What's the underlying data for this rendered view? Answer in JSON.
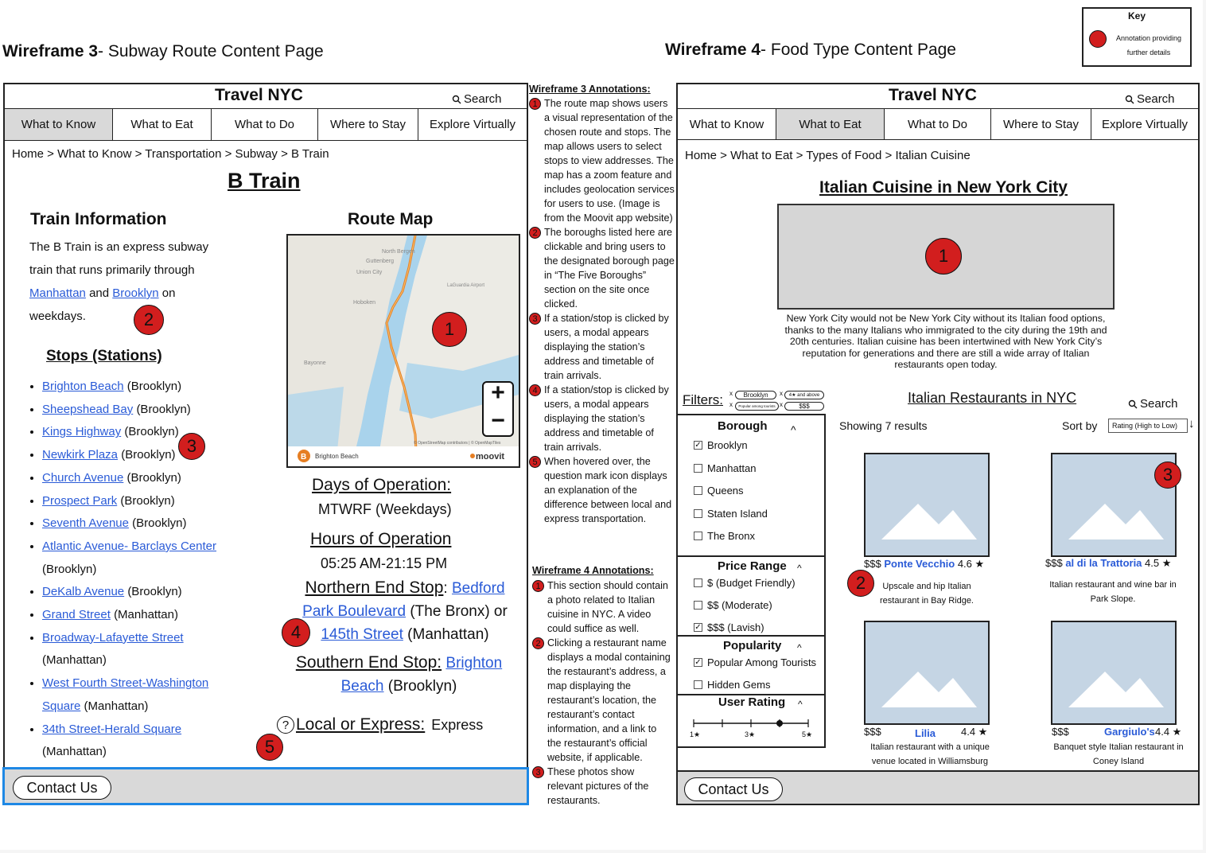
{
  "key": {
    "title": "Key",
    "label": "Annotation providing further details"
  },
  "wf3": {
    "title_bold": "Wireframe 3",
    "title_rest": "- Subway Route Content Page",
    "site_title": "Travel NYC",
    "search": "Search",
    "tabs": [
      "What to Know",
      "What to Eat",
      "What to Do",
      "Where to Stay",
      "Explore Virtually"
    ],
    "breadcrumb": "Home > What to Know > Transportation > Subway > B Train",
    "page_title": "B Train",
    "train_info_heading": "Train Information",
    "train_info_pre": "The B Train is an express subway train that runs primarily through",
    "link_manhattan": "Manhattan",
    "and": "and",
    "link_brooklyn": "Brooklyn",
    "train_info_post": "on weekdays.",
    "stops_heading": "Stops (Stations)",
    "stops": [
      {
        "name": "Brighton Beach",
        "borough": "(Brooklyn)"
      },
      {
        "name": "Sheepshead Bay",
        "borough": "(Brooklyn)"
      },
      {
        "name": "Kings Highway",
        "borough": "(Brooklyn)"
      },
      {
        "name": "Newkirk Plaza",
        "borough": "(Brooklyn)"
      },
      {
        "name": "Church Avenue",
        "borough": "(Brooklyn)"
      },
      {
        "name": "Prospect Park",
        "borough": "(Brooklyn)"
      },
      {
        "name": "Seventh Avenue",
        "borough": "(Brooklyn)"
      },
      {
        "name": "Atlantic Avenue- Barclays Center",
        "borough": "(Brooklyn)"
      },
      {
        "name": "DeKalb Avenue",
        "borough": "(Brooklyn)"
      },
      {
        "name": "Grand Street",
        "borough": "(Manhattan)"
      },
      {
        "name": "Broadway-Lafayette Street",
        "borough": "(Manhattan)"
      },
      {
        "name": "West Fourth Street-Washington Square",
        "borough": "(Manhattan)"
      },
      {
        "name": "34th Street-Herald Square",
        "borough": "(Manhattan)"
      }
    ],
    "route_map_heading": "Route Map",
    "map_labels": {
      "north_bergen": "North Bergen",
      "guttenberg": "Guttenberg",
      "union_city": "Union City",
      "laguardia": "LaGuardia Airport",
      "hoboken": "Hoboken",
      "bayonne": "Bayonne",
      "brighton_beach": "Brighton Beach",
      "moovit": "moovit",
      "attribution": "© OpenStreetMap contributors | © OpenMapTiles"
    },
    "days_heading": "Days of Operation:",
    "days_value": "MTWRF (Weekdays)",
    "hours_heading": "Hours of Operation",
    "hours_value": "05:25 AM-21:15 PM",
    "north_label": "Northern End Stop",
    "north_colon": ":",
    "north_link1": "Bedford Park Boulevard",
    "north_mid": "(The Bronx) or",
    "north_link2": "145th Street",
    "north_end": "(Manhattan)",
    "south_label": "Southern End Stop:",
    "south_link": "Brighton Beach",
    "south_end": "(Brooklyn)",
    "local_label": "Local or Express:",
    "local_value": "Express",
    "contact": "Contact Us"
  },
  "annotations": {
    "wf3_heading": "Wireframe 3 Annotations:",
    "wf3": [
      "The route map shows users a visual representation of the chosen route and stops. The map allows users to select stops to view addresses. The map has a zoom feature and includes geolocation services for users to use. (Image is from the Moovit app website)",
      "The boroughs listed here are clickable and bring users to the designated borough page in “The Five Boroughs” section on the site once clicked.",
      "If a station/stop is clicked by users, a modal appears displaying the station’s address and timetable of train arrivals.",
      "If a station/stop is clicked by users, a modal appears displaying the station’s address and timetable of train arrivals.",
      "When hovered over, the question mark icon displays an explanation of the difference between local and express transportation."
    ],
    "wf4_heading": "Wireframe 4 Annotations:",
    "wf4": [
      "This section should contain a photo related to Italian cuisine in NYC. A video could suffice as well.",
      "Clicking a restaurant name displays a modal containing the restaurant’s address, a map displaying the restaurant’s location, the restaurant’s contact information, and a link to the restaurant’s official website, if applicable.",
      "These photos show relevant pictures of the restaurants."
    ]
  },
  "wf4": {
    "title_bold": "Wireframe 4",
    "title_rest": "- Food Type Content Page",
    "site_title": "Travel NYC",
    "search": "Search",
    "tabs": [
      "What to Know",
      "What to Eat",
      "What to Do",
      "Where to Stay",
      "Explore Virtually"
    ],
    "breadcrumb": "Home > What to Eat > Types of Food > Italian Cuisine",
    "page_title": "Italian Cuisine in New York City",
    "intro": "New York City would not be New York City without its Italian food options, thanks to the many Italians who immigrated to the city during the 19th and 20th centuries. Italian cuisine has been intertwined with New York City’s reputation for generations and there are still a wide array of Italian restaurants open today.",
    "filters_label": "Filters:",
    "filter_pills": [
      "Brooklyn",
      "4★ and above",
      "Popular among tourists",
      "$$$"
    ],
    "results_heading": "Italian Restaurants in NYC",
    "results_search": "Search",
    "showing": "Showing 7 results",
    "sort_label": "Sort by",
    "sort_value": "Rating (High to Low)",
    "borough_heading": "Borough",
    "boroughs": [
      {
        "label": "Brooklyn",
        "checked": "✓"
      },
      {
        "label": "Manhattan",
        "checked": ""
      },
      {
        "label": "Queens",
        "checked": ""
      },
      {
        "label": "Staten Island",
        "checked": ""
      },
      {
        "label": "The Bronx",
        "checked": ""
      }
    ],
    "price_heading": "Price Range",
    "prices": [
      {
        "label": "$ (Budget Friendly)",
        "checked": ""
      },
      {
        "label": "$$ (Moderate)",
        "checked": ""
      },
      {
        "label": "$$$ (Lavish)",
        "checked": "✓"
      }
    ],
    "popularity_heading": "Popularity",
    "popularity": [
      {
        "label": "Popular Among Tourists",
        "checked": "✓"
      },
      {
        "label": "Hidden Gems",
        "checked": ""
      }
    ],
    "rating_heading": "User Rating",
    "rating_ticks": [
      "1★",
      "3★",
      "5★"
    ],
    "rating_value": 4,
    "caret": "^",
    "restaurants": [
      {
        "price": "$$$",
        "name": "Ponte Vecchio",
        "rating": "4.6 ★",
        "desc": "Upscale and hip Italian restaurant in Bay Ridge."
      },
      {
        "price": "$$$",
        "name": "al di la Trattoria",
        "rating": "4.5 ★",
        "desc": "Italian restaurant and wine bar in Park Slope."
      },
      {
        "price": "$$$",
        "name": "Lilia",
        "rating": "4.4 ★",
        "desc": "Italian restaurant with a unique venue located in Williamsburg"
      },
      {
        "price": "$$$",
        "name": "Gargiulo's",
        "rating": "4.4 ★",
        "desc": "Banquet style Italian restaurant in Coney Island"
      }
    ],
    "contact": "Contact Us"
  },
  "badges": [
    "1",
    "2",
    "3",
    "4",
    "5"
  ],
  "colors": {
    "annotation_red": "#d21e1e",
    "link_blue": "#2a5bd7",
    "tab_active": "#d9d9d9",
    "placeholder_blue": "#c5d5e4",
    "footer_highlight": "#1e88e5"
  }
}
